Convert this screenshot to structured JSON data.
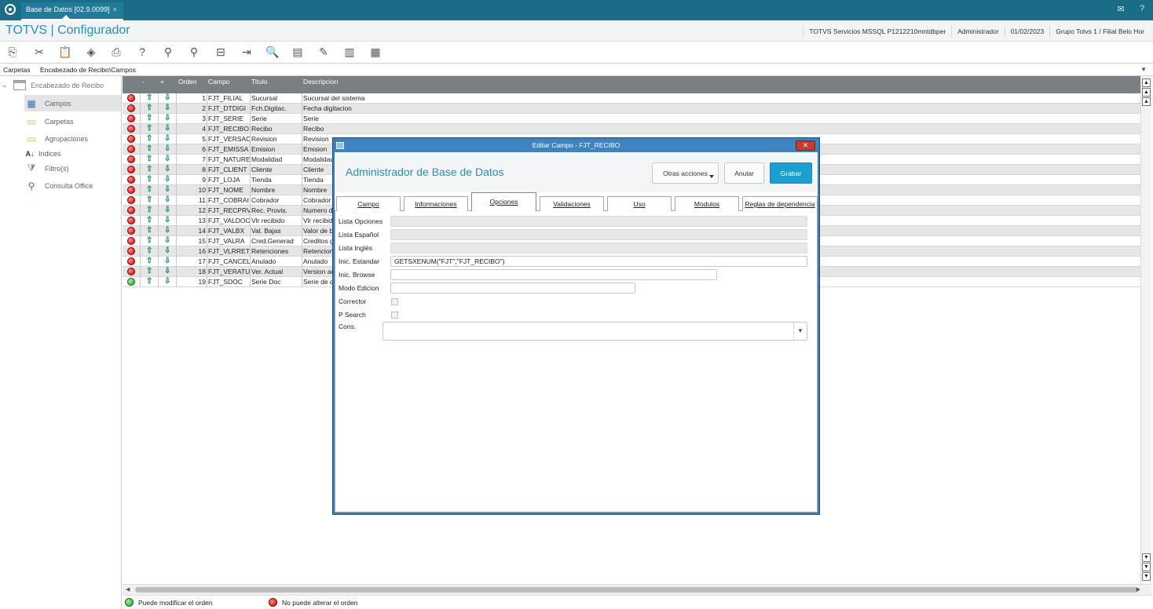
{
  "window": {
    "tab_title": "Base de Datos [02.9.0099]",
    "tab_close": "×"
  },
  "header": {
    "brand": "TOTVS | Configurador",
    "server": "TOTVS Servicios MSSQL P1212210mntdbper",
    "user": "Administrador",
    "date": "01/02/2023",
    "company": "Grupo Totvs 1 / Filial Belo Hor"
  },
  "toolbar": {
    "icons": [
      "copy-icon",
      "cut-icon",
      "paste-icon",
      "eraser-icon",
      "print-icon",
      "help-icon",
      "search-icon",
      "search-next-icon",
      "table-delete-icon",
      "exit-icon",
      "preview-icon",
      "new-document-icon",
      "edit-document-icon",
      "delete-document-icon",
      "table-icon"
    ]
  },
  "breadcrumb": {
    "label": "Carpetas",
    "path": "Encabezado de Recibo\\Campos"
  },
  "sidebar": {
    "root": "Encabezado de Recibo",
    "items": [
      {
        "label": "Campos",
        "icon": "grid-icon",
        "selected": true
      },
      {
        "label": "Carpetas",
        "icon": "folder-icon",
        "selected": false
      },
      {
        "label": "Agrupaciones",
        "icon": "folder-group-icon",
        "selected": false
      },
      {
        "label": "Indices",
        "icon": "sort-az-icon",
        "selected": false
      },
      {
        "label": "Filtro(s)",
        "icon": "filter-icon",
        "selected": false
      },
      {
        "label": "Consulta Office",
        "icon": "magnifier-icon",
        "selected": false
      }
    ]
  },
  "grid": {
    "headers": {
      "minus": "-",
      "plus": "+",
      "orden": "Orden",
      "campo": "Campo",
      "titulo": "Titulo",
      "descripcion": "Descripcion"
    },
    "rows": [
      {
        "orden": "1",
        "campo": "FJT_FILIAL",
        "titulo": "Sucursal",
        "descripcion": "Sucursal del sistema",
        "status": "red"
      },
      {
        "orden": "2",
        "campo": "FJT_DTDIGI",
        "titulo": "Fch.Digitac.",
        "descripcion": "Fecha digitacion",
        "status": "red"
      },
      {
        "orden": "3",
        "campo": "FJT_SERIE",
        "titulo": "Serie",
        "descripcion": "Serie",
        "status": "red"
      },
      {
        "orden": "4",
        "campo": "FJT_RECIBO",
        "titulo": "Recibo",
        "descripcion": "Recibo",
        "status": "red"
      },
      {
        "orden": "5",
        "campo": "FJT_VERSAC",
        "titulo": "Revision",
        "descripcion": "Revision",
        "status": "red"
      },
      {
        "orden": "6",
        "campo": "FJT_EMISSA",
        "titulo": "Emision",
        "descripcion": "Emision",
        "status": "red"
      },
      {
        "orden": "7",
        "campo": "FJT_NATURE",
        "titulo": "Modalidad",
        "descripcion": "Modalidad",
        "status": "red"
      },
      {
        "orden": "8",
        "campo": "FJT_CLIENT",
        "titulo": "Cliente",
        "descripcion": "Cliente",
        "status": "red"
      },
      {
        "orden": "9",
        "campo": "FJT_LOJA",
        "titulo": "Tienda",
        "descripcion": "Tienda",
        "status": "red"
      },
      {
        "orden": "10",
        "campo": "FJT_NOME",
        "titulo": "Nombre",
        "descripcion": "Nombre",
        "status": "red"
      },
      {
        "orden": "11",
        "campo": "FJT_COBRAI",
        "titulo": "Cobrador",
        "descripcion": "Cobrador",
        "status": "red"
      },
      {
        "orden": "12",
        "campo": "FJT_RECPRV",
        "titulo": "Rec. Provis.",
        "descripcion": "Numero de",
        "status": "red"
      },
      {
        "orden": "13",
        "campo": "FJT_VALDOC",
        "titulo": "Vlr recibido",
        "descripcion": "Vlr recibid",
        "status": "red"
      },
      {
        "orden": "14",
        "campo": "FJT_VALBX",
        "titulo": "Val. Bajas",
        "descripcion": "Valor de b",
        "status": "red"
      },
      {
        "orden": "15",
        "campo": "FJT_VALRA",
        "titulo": "Cred.Generad",
        "descripcion": "Creditos g",
        "status": "red"
      },
      {
        "orden": "16",
        "campo": "FJT_VLRRET",
        "titulo": "Retenciones",
        "descripcion": "Retencion",
        "status": "red"
      },
      {
        "orden": "17",
        "campo": "FJT_CANCEL",
        "titulo": "Anulado",
        "descripcion": "Anulado",
        "status": "red"
      },
      {
        "orden": "18",
        "campo": "FJT_VERATU",
        "titulo": "Ver. Actual",
        "descripcion": "Version ac",
        "status": "red"
      },
      {
        "orden": "19",
        "campo": "FJT_SDOC",
        "titulo": "Serie Doc",
        "descripcion": "Serie de d",
        "status": "green"
      }
    ]
  },
  "legend": {
    "green": "Puede modificar el orden",
    "red": "No puede alterar el orden"
  },
  "dialog": {
    "title": "Editar Campo - FJT_RECIBO",
    "heading": "Administrador de Base de Datos",
    "otras": "Otras acciones",
    "anular": "Anular",
    "grabar": "Grabar",
    "tabs": [
      "Campo",
      "Informaciones",
      "Opciones",
      "Validaciones",
      "Uso",
      "Modulos",
      "Reglas de dependencia"
    ],
    "active_tab": "Opciones",
    "fields": {
      "lista_opciones": "Lista Opciones",
      "lista_espanol": "Lista Español",
      "lista_ingles": "Lista Inglés",
      "inic_estandar": "Inic. Estandar",
      "inic_estandar_value": "GETSXENUM(\"FJT\",\"FJT_RECIBO\")",
      "inic_browse": "Inic. Browse",
      "modo_edicion": "Modo Edicion",
      "corrector": "Corrector",
      "p_search": "P Search",
      "cons_estandar": "Cons."
    }
  }
}
